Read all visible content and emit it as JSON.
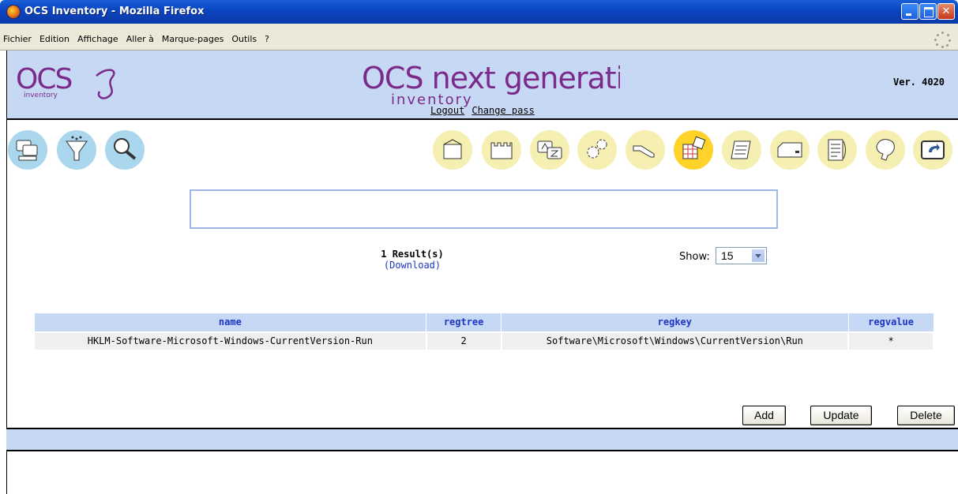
{
  "window": {
    "title": "OCS Inventory - Mozilla Firefox"
  },
  "menubar": {
    "items": [
      "Fichier",
      "Edition",
      "Affichage",
      "Aller à",
      "Marque-pages",
      "Outils",
      "?"
    ]
  },
  "header": {
    "logo_left_text": "OCS",
    "logo_left_sub": "inventory",
    "logo_center_top": "OCS next generation",
    "logo_center_sub": "inventory",
    "version": "Ver. 4020",
    "logout": "Logout",
    "change_pass": "Change pass"
  },
  "icons": {
    "left": [
      "computers-icon",
      "filter-icon",
      "search-icon"
    ],
    "right": [
      "package-icon",
      "castle-icon",
      "dictionary-icon",
      "gears-icon",
      "tools-icon",
      "registry-icon",
      "scroll-icon",
      "card-icon",
      "document-icon",
      "help-icon",
      "back-icon"
    ],
    "active": "registry-icon",
    "colors": {
      "blue": "#aad6ee",
      "yellow": "#f6efb2",
      "active": "#ffd32a"
    }
  },
  "results": {
    "count": "1 Result(s)",
    "download": "(Download)",
    "show_label": "Show:",
    "show_value": "15"
  },
  "table": {
    "headers": [
      "name",
      "regtree",
      "regkey",
      "regvalue"
    ],
    "rows": [
      [
        "HKLM-Software-Microsoft-Windows-CurrentVersion-Run",
        "2",
        "Software\\Microsoft\\Windows\\CurrentVersion\\Run",
        "*"
      ]
    ]
  },
  "actions": {
    "add": "Add",
    "update": "Update",
    "delete": "Delete"
  }
}
